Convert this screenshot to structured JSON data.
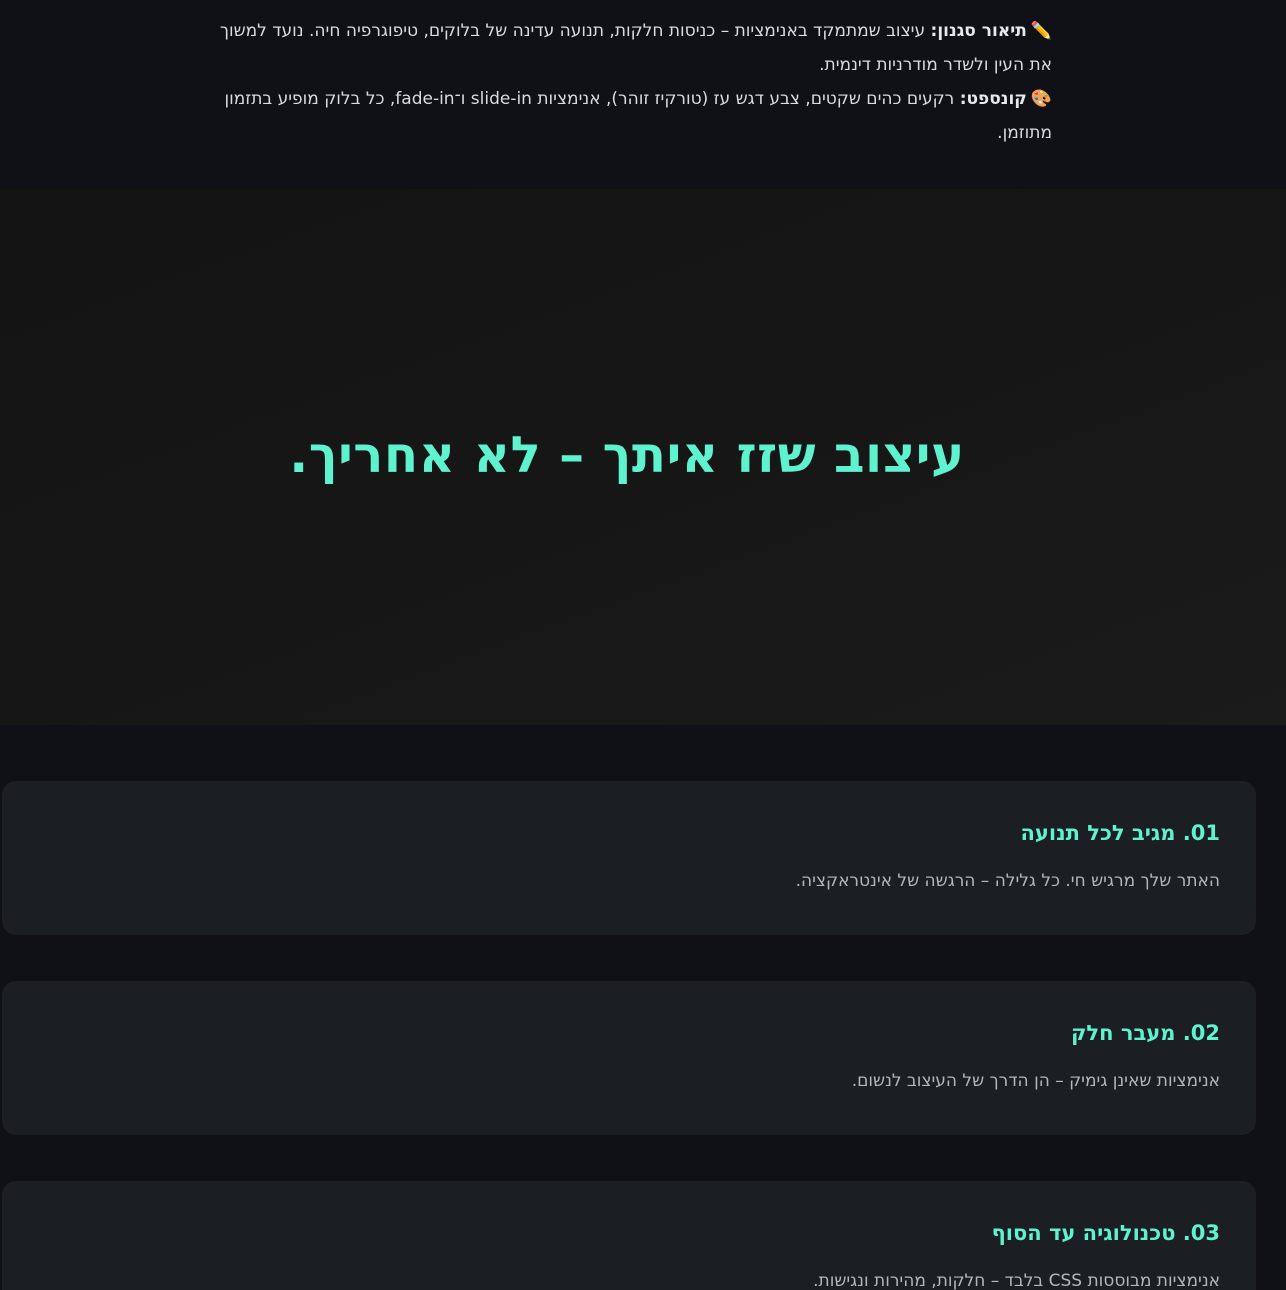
{
  "intro": {
    "style": {
      "emoji": "✏️",
      "label": "תיאור סגנון:",
      "text": "עיצוב שמתמקד באנימציות – כניסות חלקות, תנועה עדינה של בלוקים, טיפוגרפיה חיה. נועד למשוך את העין ולשדר מודרניות דינמית."
    },
    "concept": {
      "emoji": "🎨",
      "label": "קונספט:",
      "text": "רקעים כהים שקטים, צבע דגש עז (טורקיז זוהר), אנימציות slide-in ו־fade-in, כל בלוק מופיע בתזמון מתוזמן."
    }
  },
  "hero": {
    "headline": "עיצוב שזז איתך – לא אחריך."
  },
  "features": [
    {
      "title": "01. מגיב לכל תנועה",
      "text": "האתר שלך מרגיש חי. כל גלילה – הרגשה של אינטראקציה."
    },
    {
      "title": "02. מעבר חלק",
      "text": "אנימציות שאינן גימיק – הן הדרך של העיצוב לנשום."
    },
    {
      "title": "03. טכנולוגיה עד הסוף",
      "text": "אנימציות מבוססות CSS בלבד – חלקות, מהירות ונגישות."
    }
  ],
  "colors": {
    "background": "#0f1117",
    "hero_background": "#161616",
    "card_background": "#1b1e23",
    "accent": "#5ef2cf",
    "body_text": "#d9dbdf",
    "muted_text": "#b3b6bb"
  },
  "icons": [
    "pencil-icon",
    "palette-icon"
  ]
}
